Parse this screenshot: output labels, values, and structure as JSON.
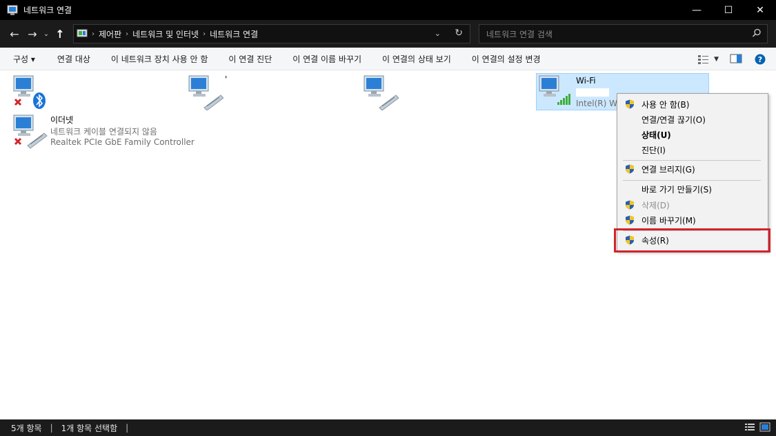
{
  "window": {
    "title": "네트워크 연결",
    "minimize": "—",
    "maximize": "☐",
    "close": "✕"
  },
  "address": {
    "breadcrumbs": [
      "제어판",
      "네트워크 및 인터넷",
      "네트워크 연결"
    ],
    "search_placeholder": "네트워크 연결 검색"
  },
  "toolbar": {
    "organize": "구성 ▾",
    "items": [
      "연결 대상",
      "이 네트워크 장치 사용 안 함",
      "이 연결 진단",
      "이 연결 이름 바꾸기",
      "이 연결의 상태 보기",
      "이 연결의 설정 변경"
    ]
  },
  "items": {
    "ethernet": {
      "name": "이더넷",
      "status": "네트워크 케이블 연결되지 않음",
      "adapter": "Realtek PCIe GbE Family Controller"
    },
    "wifi": {
      "name": "Wi-Fi",
      "adapter": "Intel(R) Wir"
    },
    "unnamed_1": "'"
  },
  "context_menu": {
    "items": [
      {
        "label": "사용 안 함(B)",
        "shield": true,
        "bold": false,
        "disabled": false
      },
      {
        "label": "연결/연결 끊기(O)",
        "shield": false,
        "bold": false,
        "disabled": false
      },
      {
        "label": "상태(U)",
        "shield": false,
        "bold": true,
        "disabled": false
      },
      {
        "label": "진단(I)",
        "shield": false,
        "bold": false,
        "disabled": false
      },
      {
        "label": "연결 브리지(G)",
        "shield": true,
        "bold": false,
        "disabled": false
      },
      {
        "label": "바로 가기 만들기(S)",
        "shield": false,
        "bold": false,
        "disabled": false
      },
      {
        "label": "삭제(D)",
        "shield": true,
        "bold": false,
        "disabled": true
      },
      {
        "label": "이름 바꾸기(M)",
        "shield": true,
        "bold": false,
        "disabled": false
      },
      {
        "label": "속성(R)",
        "shield": true,
        "bold": false,
        "disabled": false
      }
    ],
    "highlight_color": "#d3222a"
  },
  "status": {
    "count": "5개 항목",
    "selected": "1개 항목 선택함",
    "separator": "|"
  },
  "colors": {
    "titlebar": "#000000",
    "accent_blue": "#0063b1",
    "selection": "#cce8ff",
    "signal_green": "#3fae3f",
    "error_red": "#d3222a"
  }
}
